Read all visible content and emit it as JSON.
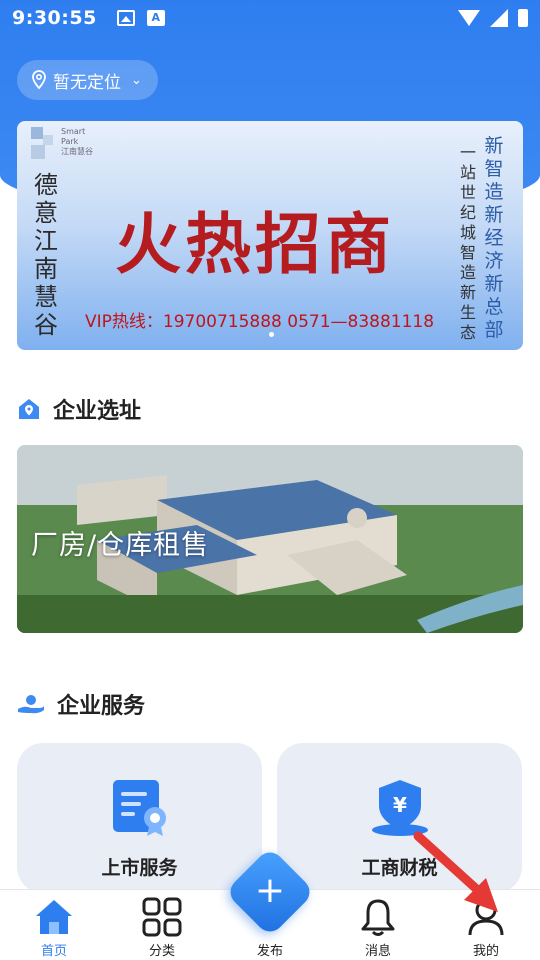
{
  "status_bar": {
    "time": "9:30:55"
  },
  "location": {
    "label": "暂无定位"
  },
  "banner": {
    "logo_line1": "Smart",
    "logo_line2": "Park",
    "logo_line3": "江南慧谷",
    "vertical_left": [
      "德",
      "意",
      "江",
      "南",
      "慧",
      "谷"
    ],
    "title": "火热招商",
    "hotline": "VIP热线：19700715888    0571—83881118",
    "col1": [
      "一",
      "站",
      "世",
      "纪",
      "城",
      "智",
      "造",
      "新",
      "生",
      "态"
    ],
    "col2": [
      "新",
      "智",
      "造",
      "新",
      "经",
      "济",
      "新",
      "总",
      "部"
    ]
  },
  "section_location": {
    "title": "企业选址"
  },
  "factory_card": {
    "label": "厂房/仓库租售"
  },
  "section_service": {
    "title": "企业服务"
  },
  "services": [
    {
      "label": "上市服务"
    },
    {
      "label": "工商财税"
    }
  ],
  "tabs": [
    {
      "label": "首页",
      "active": true
    },
    {
      "label": "分类"
    },
    {
      "label": "发布"
    },
    {
      "label": "消息"
    },
    {
      "label": "我的"
    }
  ],
  "colors": {
    "primary": "#2f7ef0",
    "banner_red": "#b51c20",
    "annotation_red": "#e53935"
  }
}
